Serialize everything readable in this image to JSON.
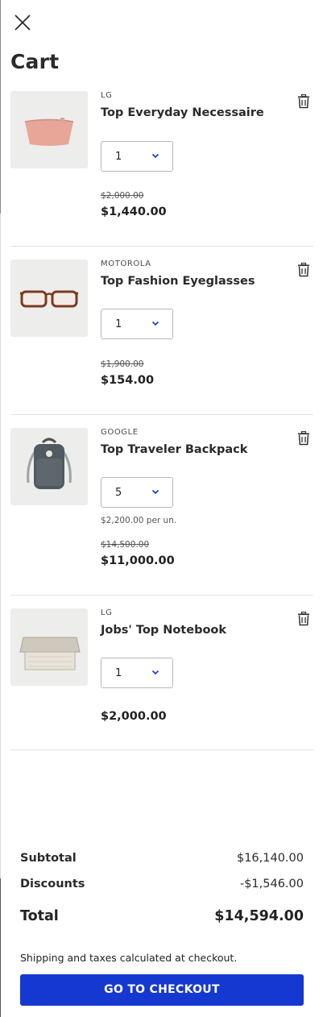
{
  "header": {
    "close_icon": "close-icon",
    "title": "Cart"
  },
  "items": [
    {
      "brand": "LG",
      "name": "Top Everyday Necessaire",
      "quantity": "1",
      "unit_note": "",
      "old_price": "$2,000.00",
      "price": "$1,440.00",
      "image_icon": "pink-pouch-image"
    },
    {
      "brand": "MOTOROLA",
      "name": "Top Fashion Eyeglasses",
      "quantity": "1",
      "unit_note": "",
      "old_price": "$1,900.00",
      "price": "$154.00",
      "image_icon": "eyeglasses-image"
    },
    {
      "brand": "GOOGLE",
      "name": "Top Traveler Backpack",
      "quantity": "5",
      "unit_note": "$2,200.00 per un.",
      "old_price": "$14,500.00",
      "price": "$11,000.00",
      "image_icon": "backpack-image"
    },
    {
      "brand": "LG",
      "name": "Jobs' Top Notebook",
      "quantity": "1",
      "unit_note": "",
      "old_price": "",
      "price": "$2,000.00",
      "image_icon": "notebook-image"
    }
  ],
  "summary": {
    "subtotal_label": "Subtotal",
    "subtotal_value": "$16,140.00",
    "discounts_label": "Discounts",
    "discounts_value": "-$1,546.00",
    "total_label": "Total",
    "total_value": "$14,594.00"
  },
  "footer": {
    "shipping_note": "Shipping and taxes calculated at checkout.",
    "checkout_label": "GO TO CHECKOUT"
  },
  "colors": {
    "accent": "#1538d1",
    "chevron": "#1538d1",
    "text": "#222222",
    "divider": "#e2e2e2"
  }
}
